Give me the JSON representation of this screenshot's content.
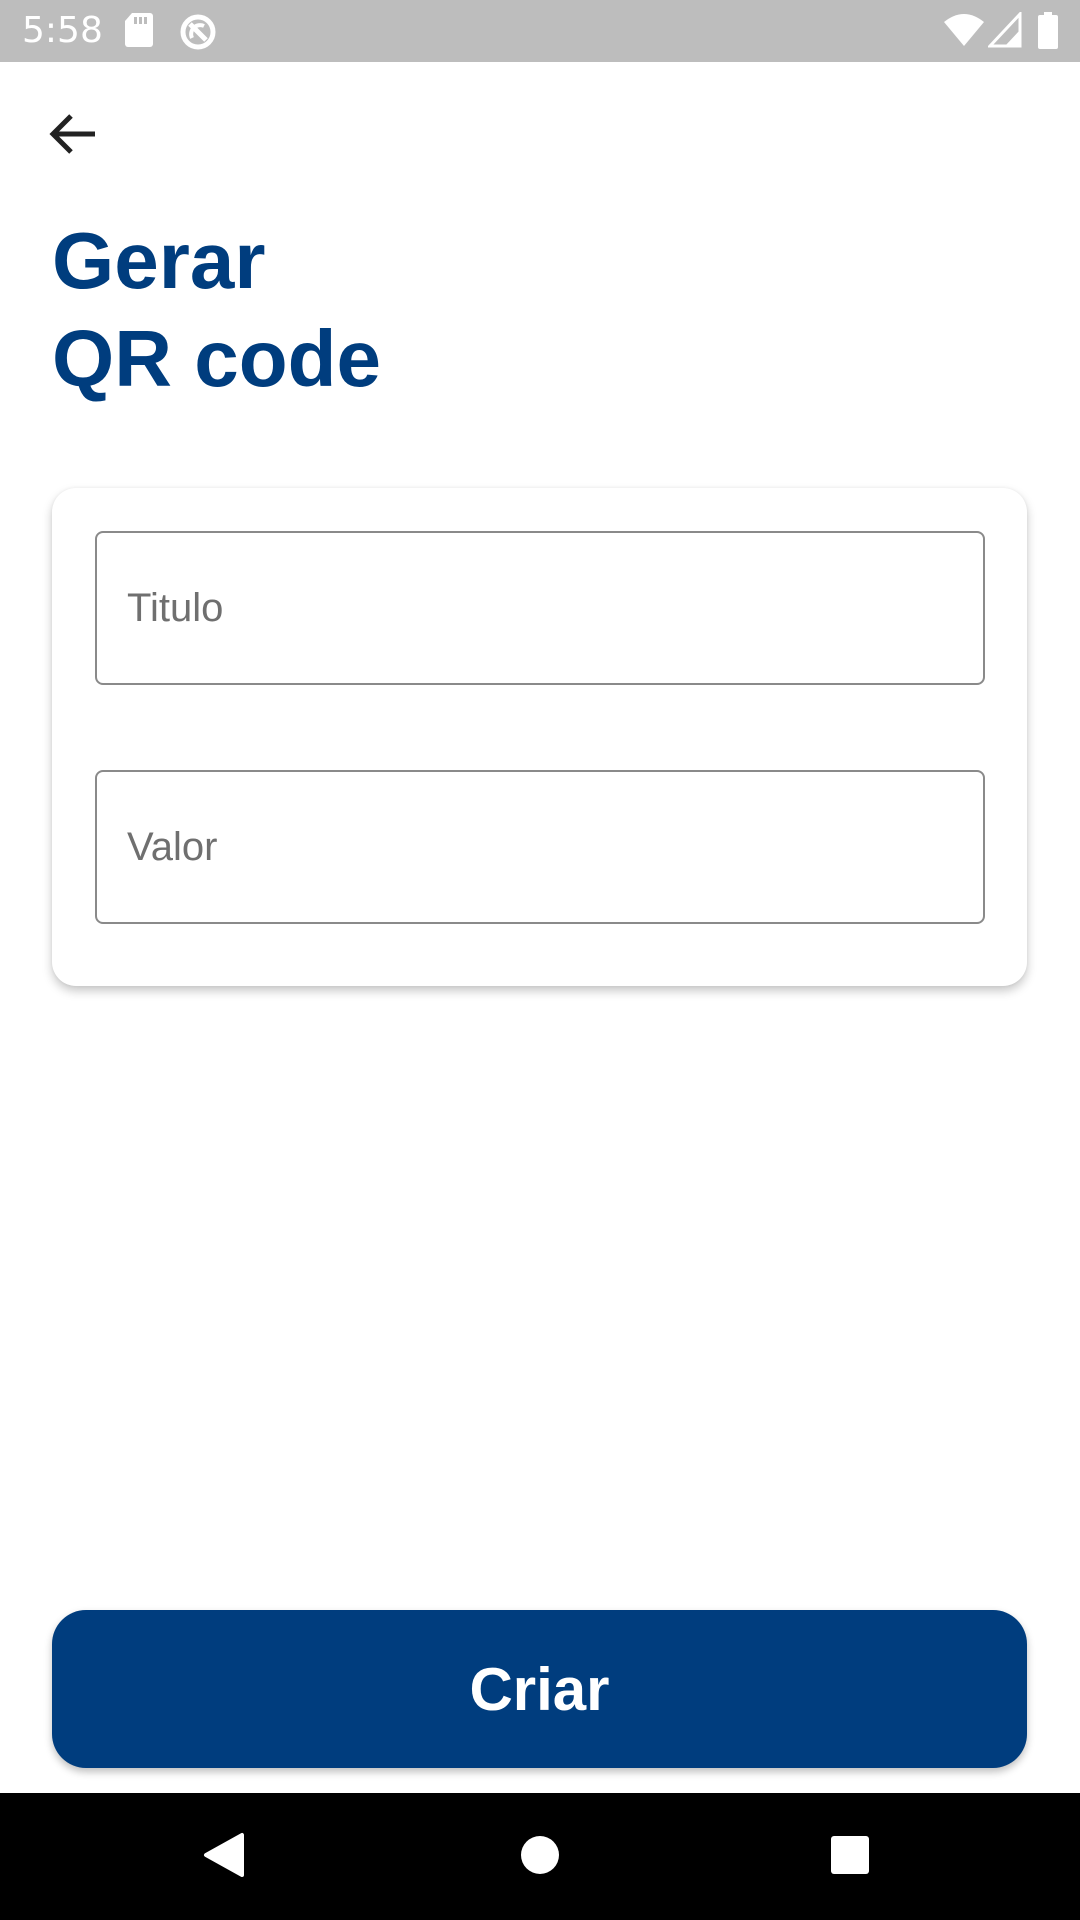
{
  "status_bar": {
    "time": "5:58",
    "icons": [
      "sd-card-icon",
      "sync-disabled-icon",
      "wifi-icon",
      "cell-signal-icon",
      "battery-icon"
    ]
  },
  "header": {
    "back_icon": "arrow-back-icon",
    "title_line1": "Gerar",
    "title_line2": "QR code"
  },
  "form": {
    "title_field": {
      "placeholder": "Titulo",
      "value": ""
    },
    "value_field": {
      "placeholder": "Valor",
      "value": ""
    }
  },
  "actions": {
    "create_label": "Criar"
  },
  "nav_bar": {
    "icons": [
      "back-triangle-icon",
      "home-circle-icon",
      "recents-square-icon"
    ]
  },
  "colors": {
    "brand": "#003d7e",
    "status_bar": "#bdbdbd",
    "nav_bar": "#000000"
  }
}
